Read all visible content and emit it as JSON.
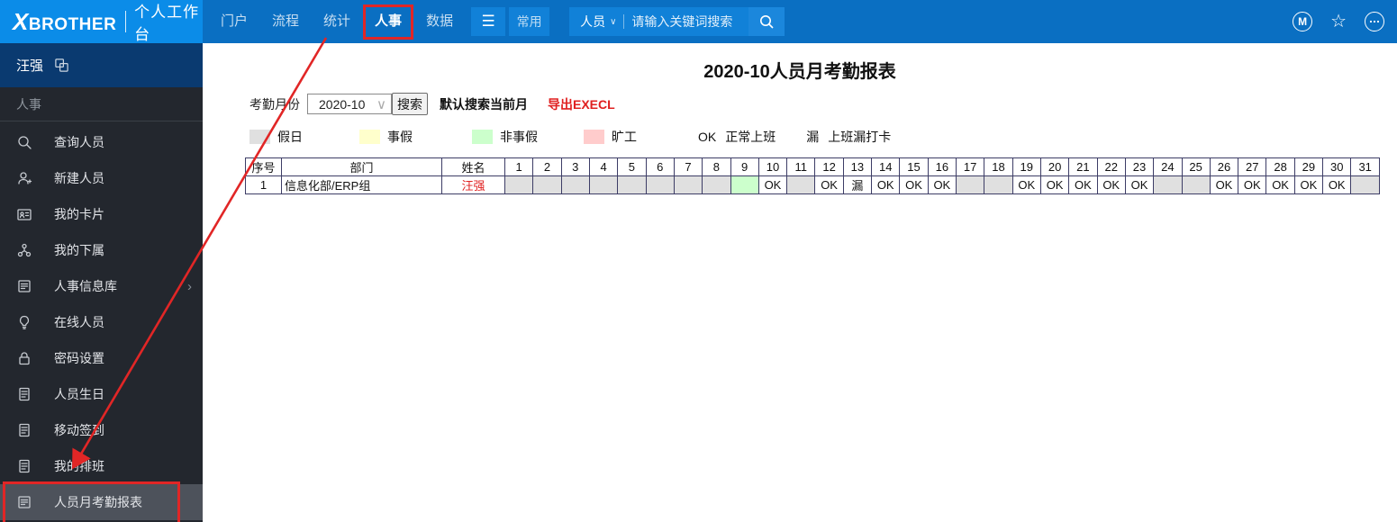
{
  "navbar": {
    "brand": "XBROTHER",
    "product": "个人工作台",
    "items": [
      {
        "label": "门户"
      },
      {
        "label": "流程"
      },
      {
        "label": "统计"
      },
      {
        "label": "人事",
        "annotated": true
      },
      {
        "label": "数据"
      }
    ],
    "quick_button": "常用",
    "search": {
      "category": "人员",
      "placeholder": "请输入关键词搜索"
    },
    "m_badge": "M"
  },
  "sidebar": {
    "user": "汪强",
    "section": "人事",
    "items": [
      {
        "label": "查询人员",
        "icon": "search"
      },
      {
        "label": "新建人员",
        "icon": "person-add"
      },
      {
        "label": "我的卡片",
        "icon": "id-card"
      },
      {
        "label": "我的下属",
        "icon": "org"
      },
      {
        "label": "人事信息库",
        "icon": "doc-list",
        "has_submenu": true
      },
      {
        "label": "在线人员",
        "icon": "bulb"
      },
      {
        "label": "密码设置",
        "icon": "lock"
      },
      {
        "label": "人员生日",
        "icon": "doc"
      },
      {
        "label": "移动签到",
        "icon": "doc"
      },
      {
        "label": "我的排班",
        "icon": "doc"
      },
      {
        "label": "人员月考勤报表",
        "icon": "doc-list",
        "active": true,
        "annotated": true
      }
    ]
  },
  "main": {
    "title": "2020-10人员月考勤报表",
    "controls": {
      "month_label": "考勤月份",
      "month_value": "2020-10",
      "search_button": "搜索",
      "hint": "默认搜索当前月",
      "export_link": "导出EXECL"
    },
    "legend": [
      {
        "swatch": "#e0e0e0",
        "label": "假日"
      },
      {
        "swatch": "#ffffcc",
        "label": "事假"
      },
      {
        "swatch": "#ccffcc",
        "label": "非事假"
      },
      {
        "swatch": "#ffcccc",
        "label": "旷工"
      },
      {
        "code": "OK",
        "label": "正常上班"
      },
      {
        "code": "漏",
        "label": "上班漏打卡"
      }
    ],
    "table": {
      "headers": [
        "序号",
        "部门",
        "姓名"
      ],
      "days": [
        1,
        2,
        3,
        4,
        5,
        6,
        7,
        8,
        9,
        10,
        11,
        12,
        13,
        14,
        15,
        16,
        17,
        18,
        19,
        20,
        21,
        22,
        23,
        24,
        25,
        26,
        27,
        28,
        29,
        30,
        31
      ],
      "rows": [
        {
          "no": "1",
          "dept": "信息化部/ERP组",
          "name": "汪强",
          "cells": [
            {
              "bg": "holiday",
              "text": ""
            },
            {
              "bg": "holiday",
              "text": ""
            },
            {
              "bg": "holiday",
              "text": ""
            },
            {
              "bg": "holiday",
              "text": ""
            },
            {
              "bg": "holiday",
              "text": ""
            },
            {
              "bg": "holiday",
              "text": ""
            },
            {
              "bg": "holiday",
              "text": ""
            },
            {
              "bg": "holiday",
              "text": ""
            },
            {
              "bg": "green",
              "text": ""
            },
            {
              "bg": "",
              "text": "OK"
            },
            {
              "bg": "holiday",
              "text": ""
            },
            {
              "bg": "",
              "text": "OK"
            },
            {
              "bg": "",
              "text": "漏"
            },
            {
              "bg": "",
              "text": "OK"
            },
            {
              "bg": "",
              "text": "OK"
            },
            {
              "bg": "",
              "text": "OK"
            },
            {
              "bg": "holiday",
              "text": ""
            },
            {
              "bg": "holiday",
              "text": ""
            },
            {
              "bg": "",
              "text": "OK"
            },
            {
              "bg": "",
              "text": "OK"
            },
            {
              "bg": "",
              "text": "OK"
            },
            {
              "bg": "",
              "text": "OK"
            },
            {
              "bg": "",
              "text": "OK"
            },
            {
              "bg": "holiday",
              "text": ""
            },
            {
              "bg": "holiday",
              "text": ""
            },
            {
              "bg": "",
              "text": "OK"
            },
            {
              "bg": "",
              "text": "OK"
            },
            {
              "bg": "",
              "text": "OK"
            },
            {
              "bg": "",
              "text": "OK"
            },
            {
              "bg": "",
              "text": "OK"
            },
            {
              "bg": "holiday",
              "text": ""
            }
          ]
        }
      ]
    }
  },
  "icons": {
    "menu": "☰",
    "chevron_down": "∨",
    "chevron_right": "›",
    "star": "☆",
    "more": "•••"
  },
  "colors": {
    "navbar": "#0a6fc2",
    "logo_bg": "#0b8ce8",
    "button_bg": "#1181d8",
    "user_bar": "#0a3a70",
    "sidebar": "#23272e",
    "sidebar_active": "#4d525b",
    "holiday": "#e0e0e0",
    "personal_leave": "#ffffcc",
    "non_personal_leave": "#ccffcc",
    "absent": "#ffcccc",
    "annotation": "#e12626",
    "link_red": "#e02020",
    "table_border": "#3d3d66"
  }
}
